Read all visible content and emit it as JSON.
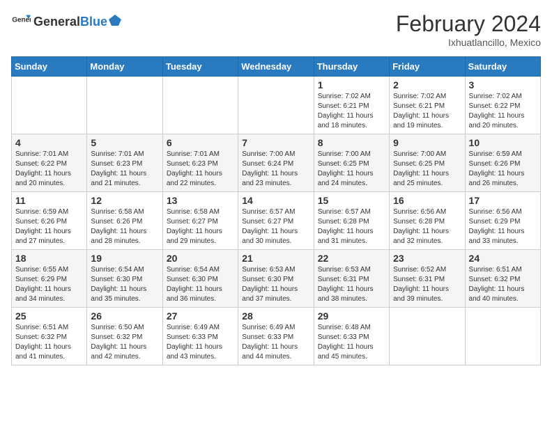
{
  "header": {
    "logo_general": "General",
    "logo_blue": "Blue",
    "month_year": "February 2024",
    "location": "Ixhuatlancillo, Mexico"
  },
  "days_of_week": [
    "Sunday",
    "Monday",
    "Tuesday",
    "Wednesday",
    "Thursday",
    "Friday",
    "Saturday"
  ],
  "weeks": [
    [
      {
        "day": "",
        "info": ""
      },
      {
        "day": "",
        "info": ""
      },
      {
        "day": "",
        "info": ""
      },
      {
        "day": "",
        "info": ""
      },
      {
        "day": "1",
        "info": "Sunrise: 7:02 AM\nSunset: 6:21 PM\nDaylight: 11 hours and 18 minutes."
      },
      {
        "day": "2",
        "info": "Sunrise: 7:02 AM\nSunset: 6:21 PM\nDaylight: 11 hours and 19 minutes."
      },
      {
        "day": "3",
        "info": "Sunrise: 7:02 AM\nSunset: 6:22 PM\nDaylight: 11 hours and 20 minutes."
      }
    ],
    [
      {
        "day": "4",
        "info": "Sunrise: 7:01 AM\nSunset: 6:22 PM\nDaylight: 11 hours and 20 minutes."
      },
      {
        "day": "5",
        "info": "Sunrise: 7:01 AM\nSunset: 6:23 PM\nDaylight: 11 hours and 21 minutes."
      },
      {
        "day": "6",
        "info": "Sunrise: 7:01 AM\nSunset: 6:23 PM\nDaylight: 11 hours and 22 minutes."
      },
      {
        "day": "7",
        "info": "Sunrise: 7:00 AM\nSunset: 6:24 PM\nDaylight: 11 hours and 23 minutes."
      },
      {
        "day": "8",
        "info": "Sunrise: 7:00 AM\nSunset: 6:25 PM\nDaylight: 11 hours and 24 minutes."
      },
      {
        "day": "9",
        "info": "Sunrise: 7:00 AM\nSunset: 6:25 PM\nDaylight: 11 hours and 25 minutes."
      },
      {
        "day": "10",
        "info": "Sunrise: 6:59 AM\nSunset: 6:26 PM\nDaylight: 11 hours and 26 minutes."
      }
    ],
    [
      {
        "day": "11",
        "info": "Sunrise: 6:59 AM\nSunset: 6:26 PM\nDaylight: 11 hours and 27 minutes."
      },
      {
        "day": "12",
        "info": "Sunrise: 6:58 AM\nSunset: 6:26 PM\nDaylight: 11 hours and 28 minutes."
      },
      {
        "day": "13",
        "info": "Sunrise: 6:58 AM\nSunset: 6:27 PM\nDaylight: 11 hours and 29 minutes."
      },
      {
        "day": "14",
        "info": "Sunrise: 6:57 AM\nSunset: 6:27 PM\nDaylight: 11 hours and 30 minutes."
      },
      {
        "day": "15",
        "info": "Sunrise: 6:57 AM\nSunset: 6:28 PM\nDaylight: 11 hours and 31 minutes."
      },
      {
        "day": "16",
        "info": "Sunrise: 6:56 AM\nSunset: 6:28 PM\nDaylight: 11 hours and 32 minutes."
      },
      {
        "day": "17",
        "info": "Sunrise: 6:56 AM\nSunset: 6:29 PM\nDaylight: 11 hours and 33 minutes."
      }
    ],
    [
      {
        "day": "18",
        "info": "Sunrise: 6:55 AM\nSunset: 6:29 PM\nDaylight: 11 hours and 34 minutes."
      },
      {
        "day": "19",
        "info": "Sunrise: 6:54 AM\nSunset: 6:30 PM\nDaylight: 11 hours and 35 minutes."
      },
      {
        "day": "20",
        "info": "Sunrise: 6:54 AM\nSunset: 6:30 PM\nDaylight: 11 hours and 36 minutes."
      },
      {
        "day": "21",
        "info": "Sunrise: 6:53 AM\nSunset: 6:30 PM\nDaylight: 11 hours and 37 minutes."
      },
      {
        "day": "22",
        "info": "Sunrise: 6:53 AM\nSunset: 6:31 PM\nDaylight: 11 hours and 38 minutes."
      },
      {
        "day": "23",
        "info": "Sunrise: 6:52 AM\nSunset: 6:31 PM\nDaylight: 11 hours and 39 minutes."
      },
      {
        "day": "24",
        "info": "Sunrise: 6:51 AM\nSunset: 6:32 PM\nDaylight: 11 hours and 40 minutes."
      }
    ],
    [
      {
        "day": "25",
        "info": "Sunrise: 6:51 AM\nSunset: 6:32 PM\nDaylight: 11 hours and 41 minutes."
      },
      {
        "day": "26",
        "info": "Sunrise: 6:50 AM\nSunset: 6:32 PM\nDaylight: 11 hours and 42 minutes."
      },
      {
        "day": "27",
        "info": "Sunrise: 6:49 AM\nSunset: 6:33 PM\nDaylight: 11 hours and 43 minutes."
      },
      {
        "day": "28",
        "info": "Sunrise: 6:49 AM\nSunset: 6:33 PM\nDaylight: 11 hours and 44 minutes."
      },
      {
        "day": "29",
        "info": "Sunrise: 6:48 AM\nSunset: 6:33 PM\nDaylight: 11 hours and 45 minutes."
      },
      {
        "day": "",
        "info": ""
      },
      {
        "day": "",
        "info": ""
      }
    ]
  ]
}
